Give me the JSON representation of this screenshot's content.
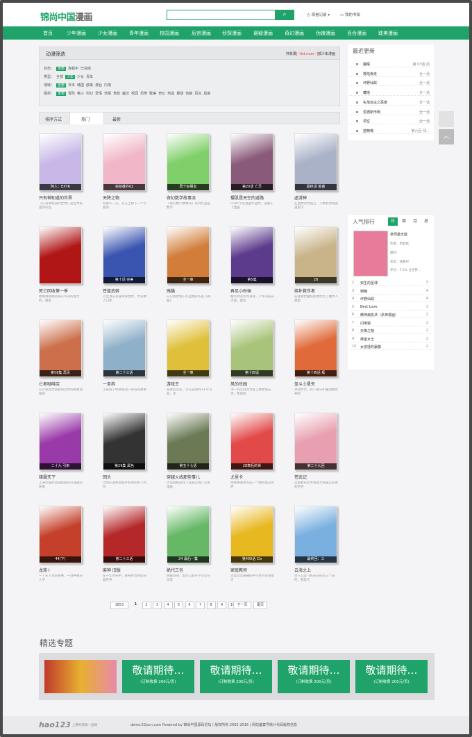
{
  "header": {
    "logo_main": "锦尚中国",
    "logo_sub": "漫画",
    "search_placeholder": "",
    "search_btn": "⌕",
    "history": "观看记录",
    "shelf": "我的书架"
  },
  "nav": [
    "首页",
    "少年漫画",
    "少女漫画",
    "青年漫画",
    "校园漫画",
    "后宫漫画",
    "侦探漫画",
    "悬疑漫画",
    "奇幻漫画",
    "伪娘漫画",
    "百合漫画",
    "耽美漫画"
  ],
  "filter": {
    "title": "动漫筛选",
    "count_prefix": "共收录",
    "count_value": "[--list.num--]",
    "count_suffix": "部少年漫画",
    "rows": [
      {
        "label": "状态：",
        "items": [
          "全部",
          "连载中",
          "已完结"
        ],
        "sel": 0
      },
      {
        "label": "类型：",
        "items": [
          "全部",
          "少年",
          "少女",
          "青年"
        ],
        "sel": 1
      },
      {
        "label": "地域：",
        "items": [
          "全部",
          "日本",
          "韩国",
          "欧美",
          "港台",
          "内地"
        ],
        "sel": 0
      },
      {
        "label": "题材：",
        "items": [
          "全部",
          "冒险",
          "格斗",
          "科幻",
          "爱情",
          "侦探",
          "竞技",
          "魔法",
          "校园",
          "恐怖",
          "耽美",
          "奇幻",
          "热血",
          "悬疑",
          "伪娘",
          "百合",
          "后宫"
        ],
        "sel": 0
      }
    ]
  },
  "tabs": {
    "label": "排序方式",
    "hot": "热门",
    "new": "最新"
  },
  "comics": [
    {
      "t": "只有神知道的世界",
      "d": "《只有神知道的世界》是若木民喜的作品",
      "ep": "阿人：EXTR",
      "c": "#c8b8e8"
    },
    {
      "t": "天降之物",
      "d": "有那么一天，从天上掉下一个可爱的",
      "ep": "完结番外02",
      "c": "#f1b7c8"
    },
    {
      "t": "奇幻数学故事派",
      "d": "《奇幻数学故事派》系列作品是数学",
      "ep": "再个好朋友",
      "c": "#7fcf6a"
    },
    {
      "t": "樱肌是天空的道路",
      "d": "CHRY小说漫画作品改，连载于《漫画",
      "ep": "第20话 亡灵",
      "c": "#8a5a7a"
    },
    {
      "t": "虚游神",
      "d": "在西界的大陆上，人类利用龙族遗留下",
      "ep": "最终话 笔番",
      "c": "#aab2c8"
    },
    {
      "t": "死亡回收第一季",
      "d": "故事讲诉拥有将心不同的能力的，搜索",
      "ep": "",
      "c": "#b01616"
    },
    {
      "t": "苍蓝武姬",
      "d": "以宝顶于武器革命世界，大多数人口死",
      "ep": "第十话 完美",
      "c": "#3a55b0"
    },
    {
      "t": "贱猫",
      "d": "只只感觉我工作室推荐作品《贱猫》",
      "ep": "全一章",
      "c": "#d27e3a"
    },
    {
      "t": "再见小时候",
      "d": "童年时的点点滴滴，少年的成长点滴，留有",
      "ep": "第5集",
      "c": "#5c3a8c"
    },
    {
      "t": "续补救世者",
      "d": "前往救世魔塔使者时为了魔界人偶后",
      "ep": "28",
      "c": "#c9b48a"
    },
    {
      "t": "亡者咖啡店",
      "d": "从小就因为能看到灵界的眼睛而备受",
      "ep": "第58集 再见",
      "c": "#cc6f4a"
    },
    {
      "t": "一条狗",
      "d": "上班辞下时期身边一条狗的故事",
      "ep": "第二十三话",
      "c": "#8fb0c9"
    },
    {
      "t": "游戏王",
      "d": "游戏的历史，可以追溯到3千年以前，也",
      "ep": "全一章",
      "c": "#e0c03a"
    },
    {
      "t": "风的乐园",
      "d": "洋一的父母因为爱上事故而去世，而后他",
      "ep": "第十四话",
      "c": "#a8c47a"
    },
    {
      "t": "圣斗士星矢",
      "d": "神话时代，有一群守护雅典娜女神的",
      "ep": "第十四话 瓶",
      "c": "#e06a3a"
    },
    {
      "t": "雄霸天下",
      "d": "上海市国际远园超脱有开漫画的研发",
      "ep": "二十九 引來",
      "c": "#9a3aaa"
    },
    {
      "t": "回头",
      "d": "当你在游移智能手机所控制下时间",
      "ep": "第29集 黑色",
      "c": "#333333"
    },
    {
      "t": "穿越火线那些事儿",
      "d": "大型网络游戏《穿越火线》衍生漫画",
      "ep": "第五十七话",
      "c": "#6b7a55"
    },
    {
      "t": "尤里卡",
      "d": "本故事讲述的是一个拥有着这世界",
      "ep": "28章后的世",
      "c": "#e24a4a"
    },
    {
      "t": "苍武记",
      "d": "自由者背武术将武力增强以武者的世界",
      "ep": "第二十九回",
      "c": "#e8a0b0"
    },
    {
      "t": "龙族 Ⅰ",
      "d": "一个天下龙的故事，一刻神祖的入学",
      "ep": "44(下)",
      "c": "#c4402a"
    },
    {
      "t": "麻神 旧版",
      "d": "在千年时光中，麻将界曾经影响着世界",
      "ep": "第二十三话",
      "c": "#b4282a"
    },
    {
      "t": "绝代三包",
      "d": "明额等待，毒包公家乡不仅仅包含是",
      "ep": "24 最后一集",
      "c": "#66b866"
    },
    {
      "t": "家庭教师",
      "d": "过着普普通通的中学生的主角纲吉",
      "ep": "第409话 Cls",
      "c": "#e8b820"
    },
    {
      "t": "云海之上",
      "d": "主人公是飞机天空的第三个冒险，我是大",
      "ep": "最终回：三",
      "c": "#7ab0e0"
    }
  ],
  "pager": {
    "total": "1853",
    "pages": [
      "1",
      "2",
      "3",
      "4",
      "5",
      "6",
      "7",
      "8",
      "9",
      "10"
    ],
    "next": "下一页",
    "last": "尾页"
  },
  "topics": {
    "title": "精选专题",
    "big": "敬请期待…",
    "small": "(订制收费 200元/页)",
    "first_label": "百变校园专题"
  },
  "sidebar": {
    "update_title": "最近更新",
    "updates": [
      {
        "n": "魔瞳",
        "c": "第 03话 前"
      },
      {
        "n": "救焰疾走",
        "c": "全一话"
      },
      {
        "n": "坏野仙踪",
        "c": "全一话"
      },
      {
        "n": "藏瑶",
        "c": "全一话"
      },
      {
        "n": "失落远古之恶度",
        "c": "全一话"
      },
      {
        "n": "爱德斯市明",
        "c": "全一话"
      },
      {
        "n": "领空",
        "c": "全一话"
      },
      {
        "n": "蓝精嘿",
        "c": "第六回 残…"
      }
    ],
    "rank_title": "人气排行",
    "rank_tabs": [
      "日",
      "周",
      "月",
      "总"
    ],
    "top": {
      "name": "老师最无敌",
      "author": "作者：周智斌",
      "genre": "题材：",
      "status": "状态：连载中",
      "rating": "评分：7.1% 让世界…"
    },
    "ranks": [
      {
        "i": "2",
        "t": "双生的星球",
        "c": "5"
      },
      {
        "i": "3",
        "t": "铠魄",
        "c": "4"
      },
      {
        "i": "4",
        "t": "坏野仙踪",
        "c": "4"
      },
      {
        "i": "5",
        "t": "Best Love",
        "c": "3"
      },
      {
        "i": "6",
        "t": "精神病执法（杀神漫画）",
        "c": "2"
      },
      {
        "i": "7",
        "t": "闪电镜",
        "c": "2"
      },
      {
        "i": "8",
        "t": "天降之物",
        "c": "2"
      },
      {
        "i": "9",
        "t": "拜金女王",
        "c": "2"
      },
      {
        "i": "10",
        "t": "女孩拯的赢藤",
        "c": "2"
      }
    ]
  },
  "footer": {
    "logo": "hao123",
    "slogan": "上网导航第一品牌",
    "text": "demo.52jscn.com Powered by 锦尚中国源码论坛 | 版权所有 2002-2016 | 网站备案号统计代码版权信息"
  }
}
